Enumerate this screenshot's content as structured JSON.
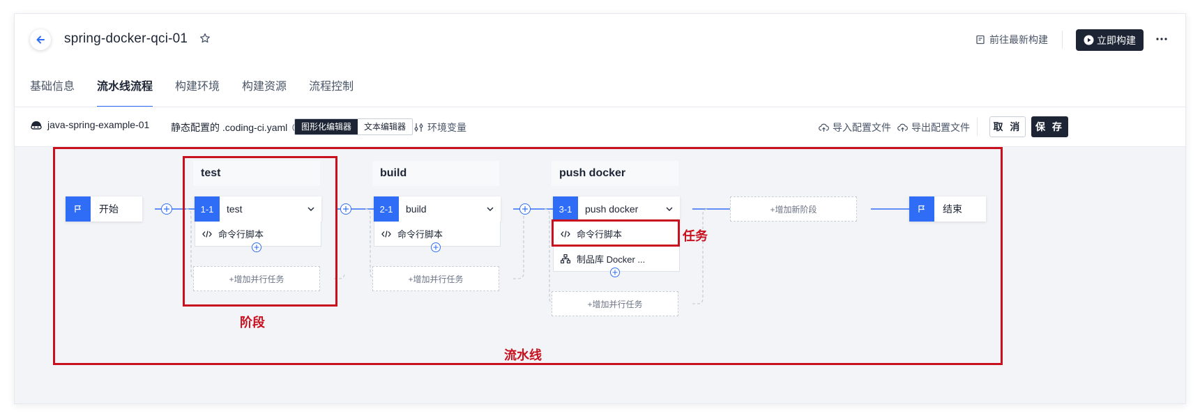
{
  "header": {
    "title": "spring-docker-qci-01",
    "latest_build_label": "前往最新构建",
    "build_now_label": "立即构建"
  },
  "tabs": [
    {
      "label": "基础信息",
      "active": false
    },
    {
      "label": "流水线流程",
      "active": true
    },
    {
      "label": "构建环境",
      "active": false
    },
    {
      "label": "构建资源",
      "active": false
    },
    {
      "label": "流程控制",
      "active": false
    }
  ],
  "toolbar": {
    "repo_name": "java-spring-example-01",
    "config_text": "静态配置的 .coding-ci.yaml",
    "editor_visual": "图形化编辑器",
    "editor_text": "文本编辑器",
    "env_vars": "环境变量",
    "import_label": "导入配置文件",
    "export_label": "导出配置文件",
    "cancel_label": "取 消",
    "save_label": "保 存"
  },
  "pipeline": {
    "start_label": "开始",
    "end_label": "结束",
    "add_stage_label": "+增加新阶段",
    "add_parallel_label": "+增加并行任务",
    "stages": [
      {
        "name": "test",
        "job_no": "1-1",
        "job_name": "test",
        "tasks": [
          "命令行脚本"
        ]
      },
      {
        "name": "build",
        "job_no": "2-1",
        "job_name": "build",
        "tasks": [
          "命令行脚本"
        ]
      },
      {
        "name": "push docker",
        "job_no": "3-1",
        "job_name": "push docker",
        "tasks": [
          "命令行脚本",
          "制品库 Docker ..."
        ]
      }
    ]
  },
  "annotations": {
    "stage_label": "阶段",
    "task_label": "任务",
    "pipeline_label": "流水线"
  },
  "colors": {
    "accent": "#2f6df6",
    "dark": "#1d2535",
    "annotation_red": "#c8101e"
  }
}
